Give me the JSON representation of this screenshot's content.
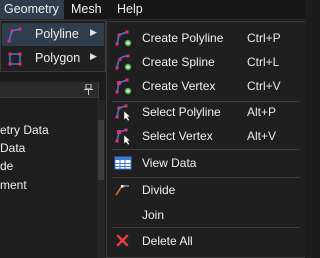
{
  "menubar": {
    "items": [
      {
        "label": "Geometry",
        "active": true
      },
      {
        "label": "Mesh",
        "active": false
      },
      {
        "label": "Help",
        "active": false
      }
    ]
  },
  "submenu": {
    "items": [
      {
        "label": "Polyline",
        "icon": "polyline-icon",
        "active": true,
        "arrow": "▶"
      },
      {
        "label": "Polygon",
        "icon": "polygon-icon",
        "active": false,
        "arrow": "▶"
      }
    ]
  },
  "dropdown": {
    "items": [
      {
        "label": "Create Polyline",
        "shortcut": "Ctrl+P",
        "icon": "create-polyline-icon"
      },
      {
        "label": "Create Spline",
        "shortcut": "Ctrl+L",
        "icon": "create-spline-icon"
      },
      {
        "label": "Create Vertex",
        "shortcut": "Ctrl+V",
        "icon": "create-vertex-icon"
      },
      {
        "label": "Select Polyline",
        "shortcut": "Alt+P",
        "icon": "select-polyline-icon"
      },
      {
        "label": "Select Vertex",
        "shortcut": "Alt+V",
        "icon": "select-vertex-icon"
      },
      {
        "label": "View Data",
        "shortcut": "",
        "icon": "table-icon"
      },
      {
        "label": "Divide",
        "shortcut": "",
        "icon": "divide-icon"
      },
      {
        "label": "Join",
        "shortcut": "",
        "icon": ""
      },
      {
        "label": "Delete All",
        "shortcut": "",
        "icon": "delete-icon"
      }
    ]
  },
  "panel": {
    "rows": [
      "etry Data",
      "Data",
      "de",
      "ment"
    ]
  },
  "colors": {
    "accent_blue": "#3a7bd5",
    "accent_pink": "#e0307a",
    "vertex_green": "#4caf50",
    "delete_red": "#e04040",
    "highlight": "#2f3d4d"
  }
}
